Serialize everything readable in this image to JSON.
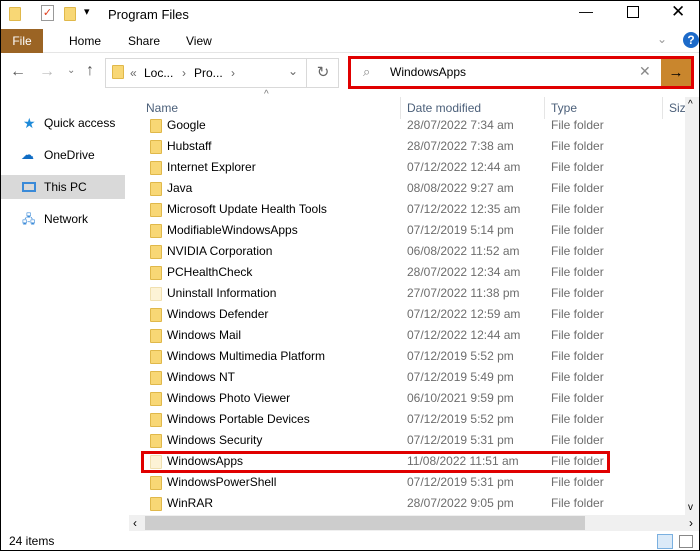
{
  "window": {
    "title": "Program Files"
  },
  "ribbon": {
    "tabs": [
      "File",
      "Home",
      "Share",
      "View"
    ]
  },
  "address": {
    "prefix": "«",
    "crumbs": [
      "Loc...",
      "Pro..."
    ]
  },
  "search": {
    "value": "WindowsApps"
  },
  "sidebar": [
    {
      "label": "Quick access",
      "icon": "star-icon"
    },
    {
      "label": "OneDrive",
      "icon": "cloud-icon"
    },
    {
      "label": "This PC",
      "icon": "computer-icon"
    },
    {
      "label": "Network",
      "icon": "network-icon"
    }
  ],
  "columns": [
    "Name",
    "Date modified",
    "Type",
    "Siz"
  ],
  "rows": [
    [
      "Google",
      "28/07/2022 7:34 am",
      "File folder"
    ],
    [
      "Hubstaff",
      "28/07/2022 7:38 am",
      "File folder"
    ],
    [
      "Internet Explorer",
      "07/12/2022 12:44 am",
      "File folder"
    ],
    [
      "Java",
      "08/08/2022 9:27 am",
      "File folder"
    ],
    [
      "Microsoft Update Health Tools",
      "07/12/2022 12:35 am",
      "File folder"
    ],
    [
      "ModifiableWindowsApps",
      "07/12/2019 5:14 pm",
      "File folder"
    ],
    [
      "NVIDIA Corporation",
      "06/08/2022 11:52 am",
      "File folder"
    ],
    [
      "PCHealthCheck",
      "28/07/2022 12:34 am",
      "File folder"
    ],
    [
      "Uninstall Information",
      "27/07/2022 11:38 pm",
      "File folder"
    ],
    [
      "Windows Defender",
      "07/12/2022 12:59 am",
      "File folder"
    ],
    [
      "Windows Mail",
      "07/12/2022 12:44 am",
      "File folder"
    ],
    [
      "Windows Multimedia Platform",
      "07/12/2019 5:52 pm",
      "File folder"
    ],
    [
      "Windows NT",
      "07/12/2019 5:49 pm",
      "File folder"
    ],
    [
      "Windows Photo Viewer",
      "06/10/2021 9:59 pm",
      "File folder"
    ],
    [
      "Windows Portable Devices",
      "07/12/2019 5:52 pm",
      "File folder"
    ],
    [
      "Windows Security",
      "07/12/2019 5:31 pm",
      "File folder"
    ],
    [
      "WindowsApps",
      "11/08/2022 11:51 am",
      "File folder"
    ],
    [
      "WindowsPowerShell",
      "07/12/2019 5:31 pm",
      "File folder"
    ],
    [
      "WinRAR",
      "28/07/2022 9:05 pm",
      "File folder"
    ]
  ],
  "status": {
    "count": "24 items"
  }
}
